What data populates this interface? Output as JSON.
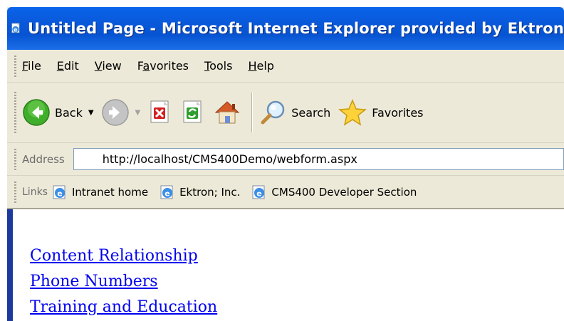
{
  "window": {
    "title": "Untitled Page - Microsoft Internet Explorer provided by Ektron",
    "app_icon": "ie-page-icon"
  },
  "menubar": {
    "items": [
      {
        "accel": "F",
        "rest": "ile"
      },
      {
        "accel": "E",
        "rest": "dit"
      },
      {
        "accel": "V",
        "rest": "iew"
      },
      {
        "prefix": "F",
        "accel": "a",
        "rest": "vorites"
      },
      {
        "accel": "T",
        "rest": "ools"
      },
      {
        "accel": "H",
        "rest": "elp"
      }
    ]
  },
  "toolbar": {
    "back_label": "Back",
    "search_label": "Search",
    "favorites_label": "Favorites",
    "icons": [
      "back-arrow-icon",
      "forward-arrow-icon",
      "stop-icon",
      "refresh-icon",
      "home-icon",
      "search-icon",
      "favorites-star-icon"
    ]
  },
  "address": {
    "label": "Address",
    "url": "http://localhost/CMS400Demo/webform.aspx"
  },
  "links": {
    "label": "Links",
    "items": [
      "Intranet home",
      "Ektron; Inc.",
      "CMS400 Developer Section"
    ]
  },
  "page": {
    "links": [
      "Content Relationship",
      "Phone Numbers",
      "Training and Education"
    ]
  },
  "colors": {
    "titlebar": "#0a59db",
    "link": "#0000ee",
    "chrome": "#ece9d8"
  }
}
